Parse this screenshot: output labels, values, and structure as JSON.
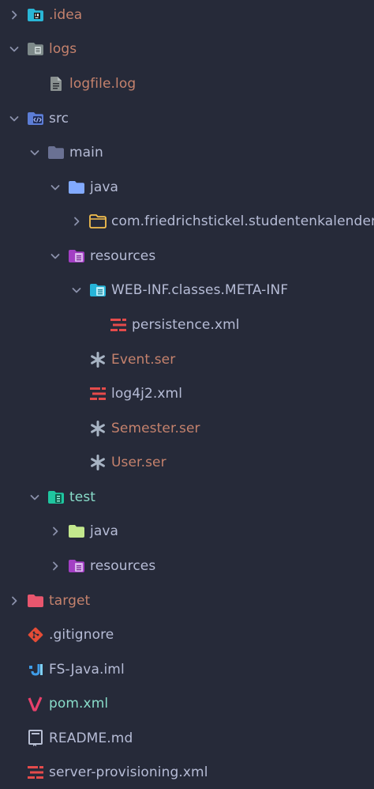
{
  "explorer": {
    "items": [
      {
        "label": ".idea",
        "icon": "idea-folder-icon"
      },
      {
        "label": "logs",
        "icon": "logs-folder-icon"
      },
      {
        "label": "logfile.log",
        "icon": "log-file-icon"
      },
      {
        "label": "src",
        "icon": "src-folder-icon"
      },
      {
        "label": "main",
        "icon": "folder-icon"
      },
      {
        "label": "java",
        "icon": "java-folder-icon"
      },
      {
        "label": "com.friedrichstickel.studentenkalender",
        "icon": "package-folder-icon"
      },
      {
        "label": "resources",
        "icon": "resources-folder-icon"
      },
      {
        "label": "WEB-INF.classes.META-INF",
        "icon": "config-folder-icon"
      },
      {
        "label": "persistence.xml",
        "icon": "xml-file-icon"
      },
      {
        "label": "Event.ser",
        "icon": "asterisk-file-icon"
      },
      {
        "label": "log4j2.xml",
        "icon": "xml-file-icon"
      },
      {
        "label": "Semester.ser",
        "icon": "asterisk-file-icon"
      },
      {
        "label": "User.ser",
        "icon": "asterisk-file-icon"
      },
      {
        "label": "test",
        "icon": "test-folder-icon"
      },
      {
        "label": "java",
        "icon": "java-folder-icon"
      },
      {
        "label": "resources",
        "icon": "resources-folder-icon"
      },
      {
        "label": "target",
        "icon": "target-folder-icon"
      },
      {
        "label": ".gitignore",
        "icon": "git-icon"
      },
      {
        "label": "FS-Java.iml",
        "icon": "intellij-module-icon"
      },
      {
        "label": "pom.xml",
        "icon": "maven-icon"
      },
      {
        "label": "README.md",
        "icon": "readme-book-icon"
      },
      {
        "label": "server-provisioning.xml",
        "icon": "xml-file-icon"
      }
    ]
  },
  "colors": {
    "background": "#262a39",
    "text_normal": "#b6bcd6",
    "text_ignored": "#c5826d",
    "text_added": "#89ddca"
  }
}
